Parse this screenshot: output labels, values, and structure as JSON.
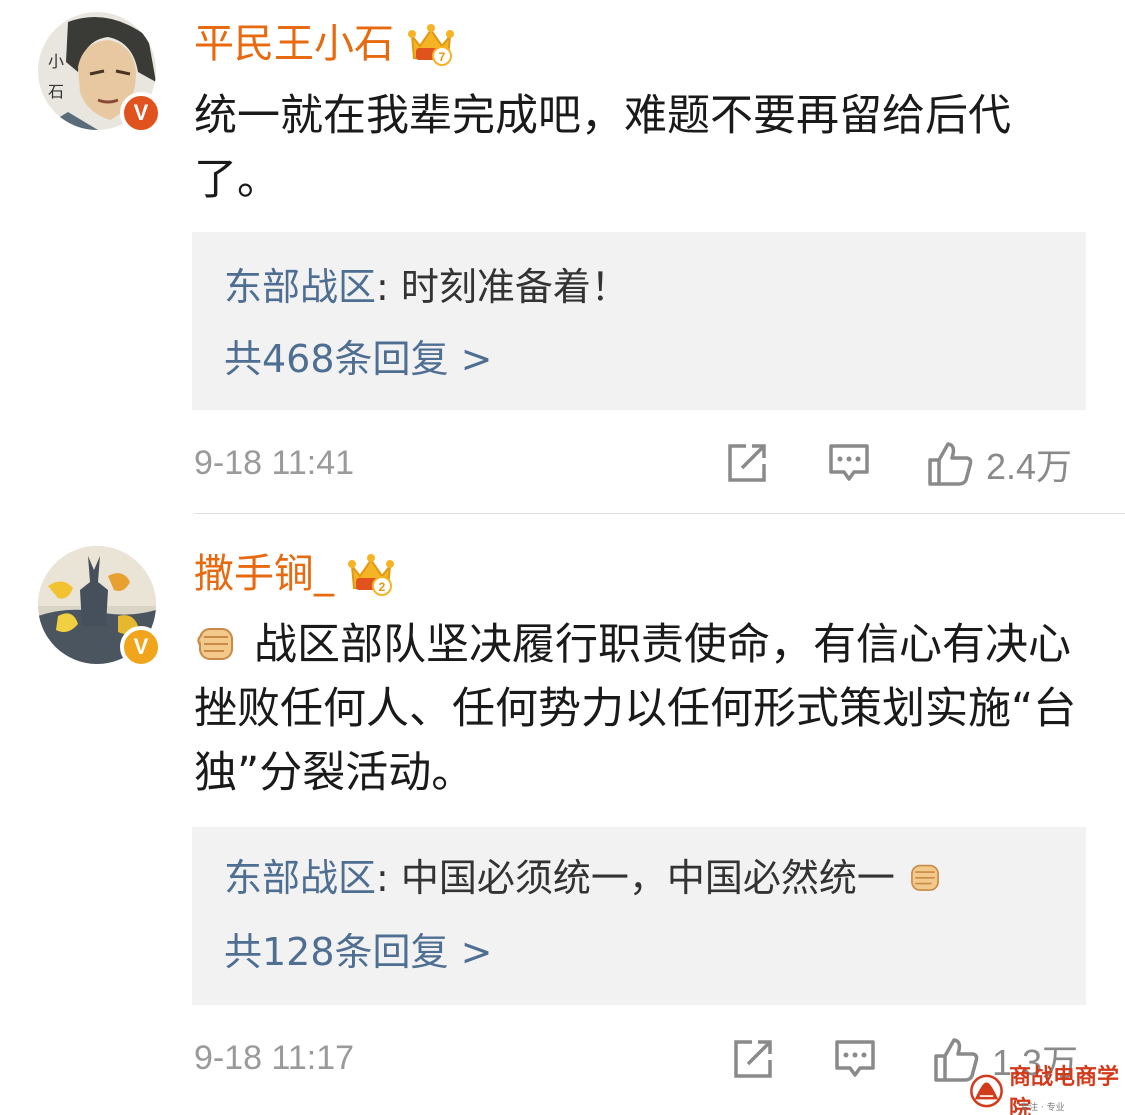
{
  "comments": [
    {
      "username": "平民王小石",
      "crown_level": "7",
      "badge_color": "#e0531f",
      "text": "统一就在我辈完成吧，难题不要再留给后代了。",
      "reply": {
        "author": "东部战区",
        "separator": ": ",
        "text": "时刻准备着！",
        "count_label": "共468条回复 >"
      },
      "time": "9-18 11:41",
      "likes": "2.4万"
    },
    {
      "username": "撒手锏_",
      "crown_level": "2",
      "badge_color": "#f0a51c",
      "text": "战区部队坚决履行职责使命，有信心有决心挫败任何人、任何势力以任何形式策划实施“台独”分裂活动。",
      "reply": {
        "author": "东部战区",
        "separator": ": ",
        "text": "中国必须统一，中国必然统一",
        "count_label": "共128条回复 >"
      },
      "time": "9-18 11:17",
      "likes": "1.3万"
    }
  ],
  "icons": [
    "share-icon",
    "comment-icon",
    "like-icon",
    "fist-emoji-icon",
    "crown-icon",
    "verified-badge-icon"
  ],
  "watermark": {
    "text": "商战电商学院",
    "subtext": "专注 · 专业"
  },
  "colors": {
    "username": "#e86a10",
    "reply_author": "#4e6e92",
    "reply_bg": "#f2f2f2",
    "meta": "#9a9a9a"
  }
}
